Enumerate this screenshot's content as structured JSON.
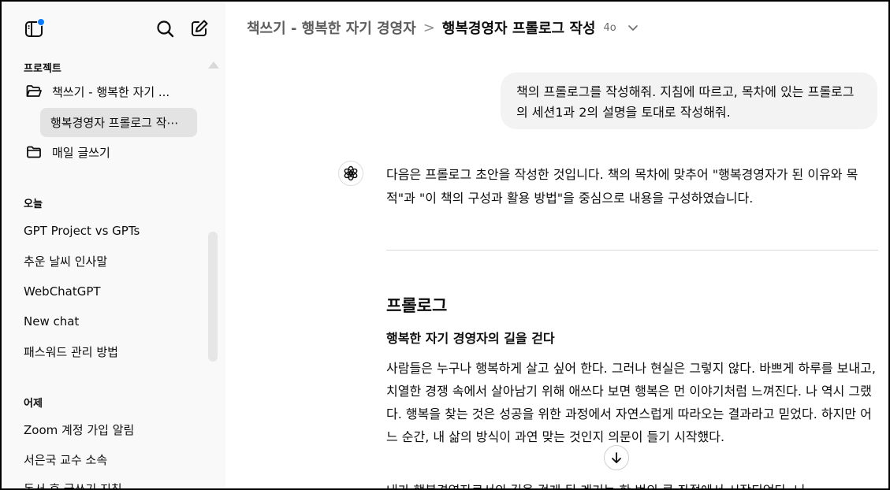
{
  "sidebar": {
    "projects_heading": "프로젝트",
    "projects": [
      {
        "label": "책쓰기 - 행복한 자기 ...",
        "icon": "folder-open-icon"
      },
      {
        "label": "행복경영자 프롤로그 작⋯",
        "selected": true
      },
      {
        "label": "매일 글쓰기",
        "icon": "folder-icon"
      }
    ],
    "today_heading": "오늘",
    "today": [
      "GPT Project vs GPTs",
      "추운 날씨 인사말",
      "WebChatGPT",
      "New chat",
      "패스워드 관리 방법"
    ],
    "yesterday_heading": "어제",
    "yesterday": [
      "Zoom 계정 가입 알림",
      "서은국 교수 소속",
      "독서 후 글쓰기 지침"
    ]
  },
  "header": {
    "project": "책쓰기 - 행복한 자기 경영자",
    "separator": ">",
    "chat_title": "행복경영자 프롤로그 작성",
    "model": "4o"
  },
  "conversation": {
    "user_message": "책의 프롤로그를 작성해줘. 지침에 따르고, 목차에 있는 프롤로그의 세션1과 2의 설명을 토대로 작성해줘.",
    "assistant_intro": "다음은 프롤로그 초안을 작성한 것입니다. 책의 목차에 맞추어 \"행복경영자가 된 이유와 목적\"과 \"이 책의 구성과 활용 방법\"을 중심으로 내용을 구성하였습니다.",
    "heading": "프롤로그",
    "subheading": "행복한 자기 경영자의 길을 걷다",
    "paragraph": "사람들은 누구나 행복하게 살고 싶어 한다. 그러나 현실은 그렇지 않다. 바쁘게 하루를 보내고, 치열한 경쟁 속에서 살아남기 위해 애쓰다 보면 행복은 먼 이야기처럼 느껴진다. 나 역시 그랬다. 행복을 찾는 것은 성공을 위한 과정에서 자연스럽게 따라오는 결과라고 믿었다. 하지만 어느 순간, 내 삶의 방식이 과연 맞는 것인지 의문이 들기 시작했다.",
    "paragraph_next": "내가 행복경영자로서의 길을 걷게 된 계기는 한 번의 큰 좌절에서 시작되었다. 나"
  },
  "colors": {
    "sidebar_bg": "#f9f9f9",
    "selected_bg": "#e3e3e3",
    "bubble_bg": "#f3f3f3",
    "notification_dot": "#0d7bff"
  }
}
